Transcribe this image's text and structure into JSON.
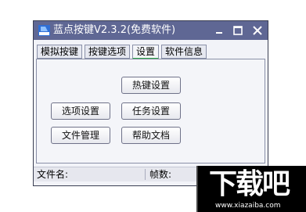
{
  "window": {
    "title": "蓝点按键V2.3.2(免费软件)"
  },
  "title_buttons": {
    "minimize_icon": "minimize-icon",
    "maximize_icon": "maximize-icon",
    "close_icon": "close-icon"
  },
  "tabs": [
    {
      "label": "模拟按键"
    },
    {
      "label": "按键选项"
    },
    {
      "label": "设置",
      "active": true
    },
    {
      "label": "软件信息"
    }
  ],
  "buttons": {
    "hotkey_settings": "热键设置",
    "option_settings": "选项设置",
    "task_settings": "任务设置",
    "file_management": "文件管理",
    "help_docs": "帮助文档"
  },
  "status_bar": {
    "filename_label": "文件名:",
    "frames_label": "帧数:"
  },
  "watermark": {
    "logo_text": "下载吧",
    "url": "www.xiazaiba.com"
  },
  "colors": {
    "titlebar": "#5f6794",
    "active_tab_accent": "#2ea84a"
  }
}
